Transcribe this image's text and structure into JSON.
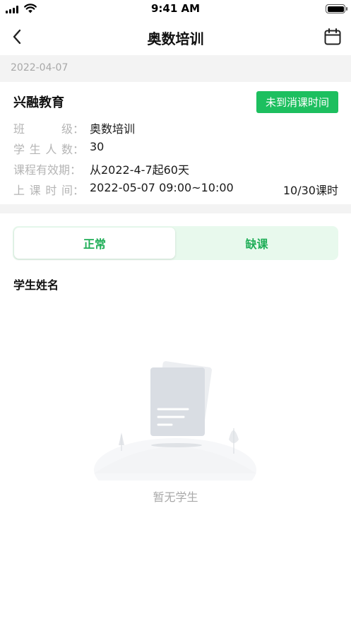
{
  "status_bar": {
    "time": "9:41 AM"
  },
  "nav": {
    "title": "奥数培训",
    "back_icon": "chevron-left-icon",
    "calendar_icon": "calendar-icon"
  },
  "date": "2022-04-07",
  "card": {
    "org_name": "兴融教育",
    "status_button": "未到消课时间",
    "rows": [
      {
        "label": [
          "班",
          "级："
        ],
        "value": "奥数培训",
        "extra": ""
      },
      {
        "label": [
          "学",
          "生",
          "人",
          "数："
        ],
        "value": "30",
        "extra": ""
      },
      {
        "label": [
          "课程有效期："
        ],
        "value": "从2022-4-7起60天",
        "extra": ""
      },
      {
        "label": [
          "上",
          "课",
          "时",
          "间："
        ],
        "value": "2022-05-07 09:00~10:00",
        "extra": "10/30课时"
      }
    ]
  },
  "tabs": {
    "normal": "正常",
    "absent": "缺课"
  },
  "section_title": "学生姓名",
  "empty_state": {
    "text": "暂无学生"
  },
  "colors": {
    "accent": "#1dbf5f",
    "tab_bg": "#e8f9ed",
    "muted": "#b5b5b5"
  }
}
